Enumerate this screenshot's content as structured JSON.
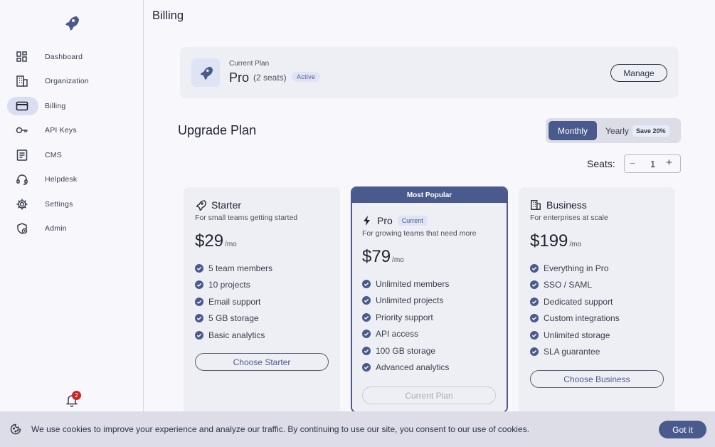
{
  "colors": {
    "accent": "#4a5a8c",
    "active_bg": "#d9dff0",
    "card_bg": "#eeeff5",
    "badge_red": "#c62828"
  },
  "sidebar": {
    "logo_icon": "rocket-icon",
    "items": [
      {
        "label": "Dashboard",
        "icon": "dashboard-icon"
      },
      {
        "label": "Organization",
        "icon": "building-icon"
      },
      {
        "label": "Billing",
        "icon": "credit-card-icon",
        "active": true
      },
      {
        "label": "API Keys",
        "icon": "key-icon"
      },
      {
        "label": "CMS",
        "icon": "document-icon"
      },
      {
        "label": "Helpdesk",
        "icon": "headset-icon"
      },
      {
        "label": "Settings",
        "icon": "gear-icon"
      },
      {
        "label": "Admin",
        "icon": "admin-icon"
      }
    ],
    "notifications": {
      "count": "2",
      "icon": "bell-icon"
    }
  },
  "header": {
    "title": "Billing"
  },
  "current_plan": {
    "label": "Current Plan",
    "plan": "Pro",
    "seats": "(2 seats)",
    "status": "Active",
    "manage_label": "Manage"
  },
  "upgrade": {
    "title": "Upgrade Plan",
    "billing_toggle": {
      "monthly": "Monthly",
      "yearly": "Yearly",
      "save_badge": "Save 20%",
      "selected": "Monthly"
    },
    "seats": {
      "label": "Seats:",
      "value": "1",
      "minus": "−",
      "plus": "+"
    }
  },
  "plans": [
    {
      "name": "Starter",
      "icon": "rocket-icon",
      "description": "For small teams getting started",
      "price": "$29",
      "period": "/mo",
      "features": [
        "5 team members",
        "10 projects",
        "Email support",
        "5 GB storage",
        "Basic analytics"
      ],
      "button": "Choose Starter"
    },
    {
      "name": "Pro",
      "icon": "bolt-icon",
      "ribbon": "Most Popular",
      "badge": "Current",
      "description": "For growing teams that need more",
      "price": "$79",
      "period": "/mo",
      "features": [
        "Unlimited members",
        "Unlimited projects",
        "Priority support",
        "API access",
        "100 GB storage",
        "Advanced analytics"
      ],
      "button": "Current Plan"
    },
    {
      "name": "Business",
      "icon": "building-icon",
      "description": "For enterprises at scale",
      "price": "$199",
      "period": "/mo",
      "features": [
        "Everything in Pro",
        "SSO / SAML",
        "Dedicated support",
        "Custom integrations",
        "Unlimited storage",
        "SLA guarantee"
      ],
      "button": "Choose Business"
    }
  ],
  "cookie_banner": {
    "icon": "cookie-icon",
    "text": "We use cookies to improve your experience and analyze our traffic. By continuing to use our site, you consent to our use of cookies.",
    "button": "Got it"
  }
}
